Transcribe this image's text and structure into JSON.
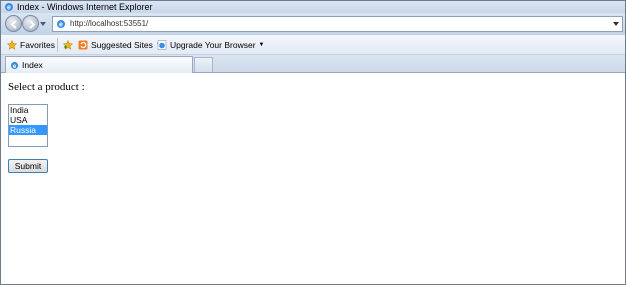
{
  "window": {
    "title": "Index - Windows Internet Explorer",
    "icon": "ie-icon"
  },
  "navigation": {
    "back_icon": "back-arrow-icon",
    "forward_icon": "forward-arrow-icon",
    "url": "http://localhost:53551/"
  },
  "favorites_bar": {
    "favorites_label": "Favorites",
    "suggested_sites_label": "Suggested Sites",
    "upgrade_browser_label": "Upgrade Your Browser"
  },
  "tabs": [
    {
      "label": "Index",
      "active": true
    }
  ],
  "page": {
    "prompt": "Select a product :",
    "products": [
      "India",
      "USA",
      "Russia"
    ],
    "selected_product": "Russia",
    "submit_label": "Submit"
  },
  "colors": {
    "selection": "#3399ff",
    "chrome": "#c7d6ea",
    "button_border": "#3c7fb1"
  }
}
